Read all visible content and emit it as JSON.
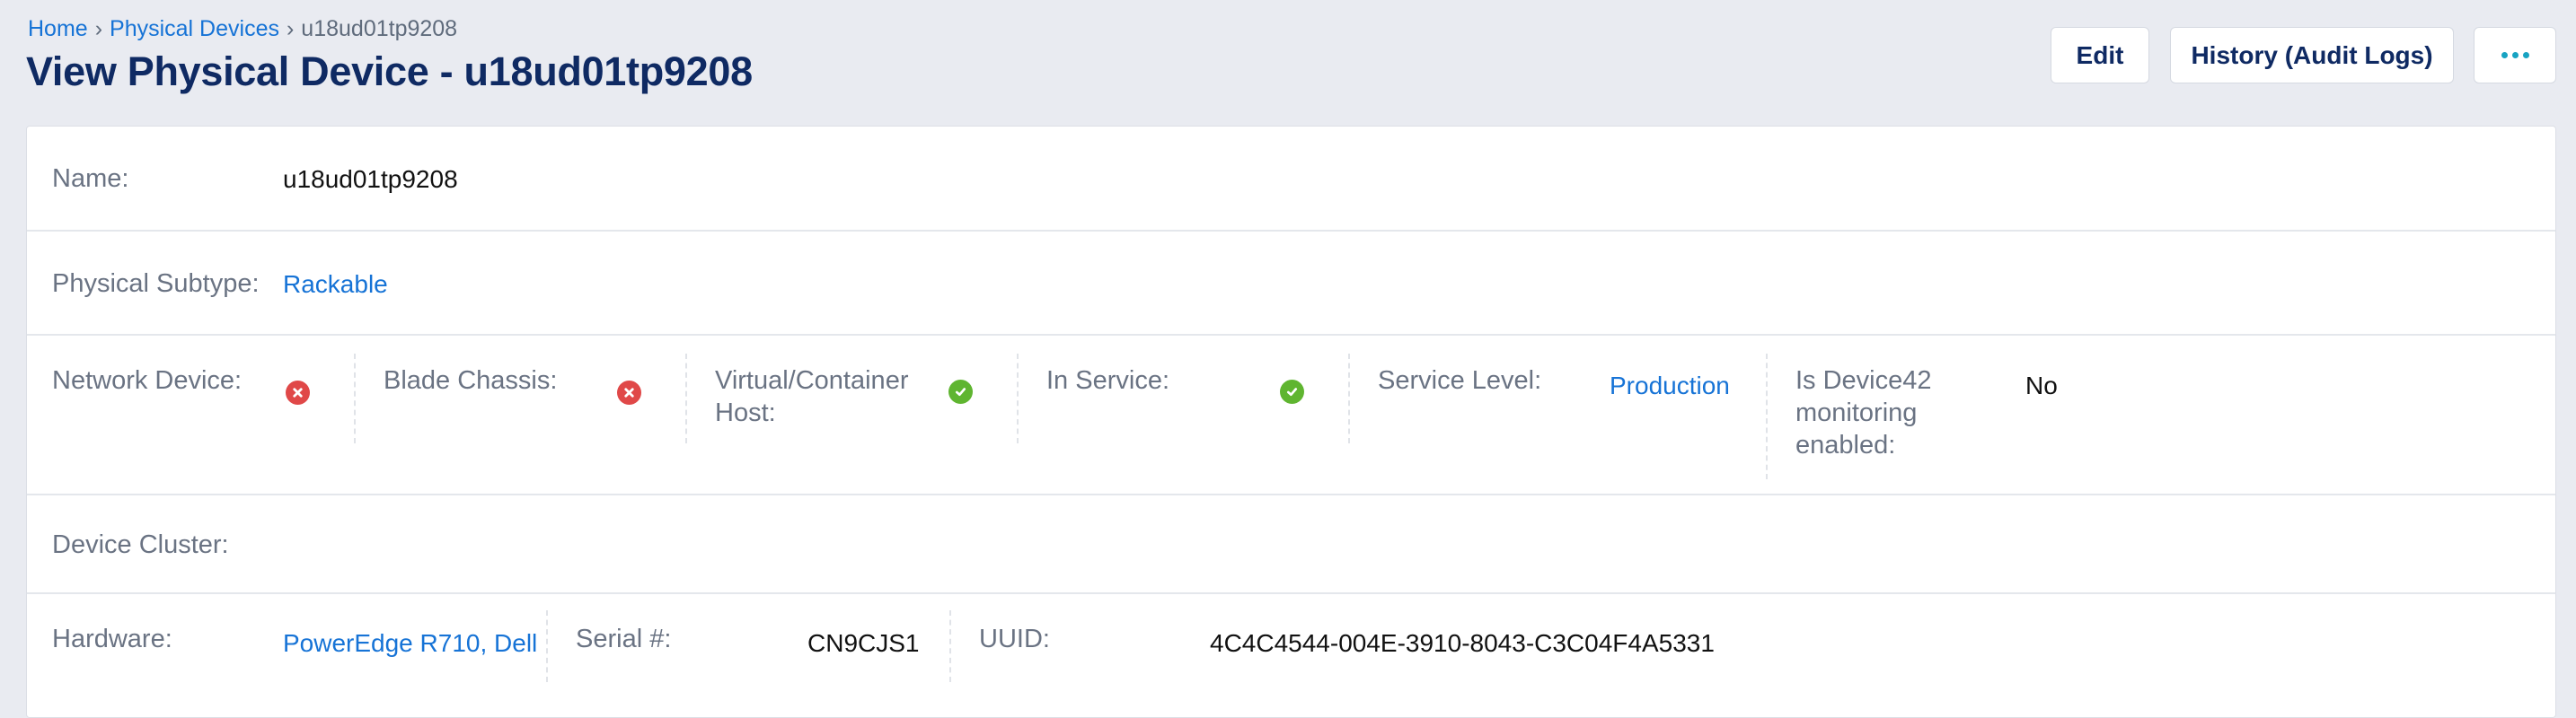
{
  "breadcrumb": {
    "home": "Home",
    "section": "Physical Devices",
    "current": "u18ud01tp9208"
  },
  "page": {
    "title": "View Physical Device - u18ud01tp9208"
  },
  "actions": {
    "edit": "Edit",
    "history": "History (Audit Logs)",
    "more_icon": "more-horizontal-icon"
  },
  "colors": {
    "accent_link": "#1673d6",
    "title": "#0f2a63",
    "status_no": "#e04848",
    "status_yes": "#5fb530",
    "more_dots": "#17a3c2"
  },
  "device": {
    "name": {
      "label": "Name:",
      "value": "u18ud01tp9208"
    },
    "physical_subtype": {
      "label": "Physical Subtype:",
      "value": "Rackable"
    },
    "network_device": {
      "label": "Network Device:",
      "value": false,
      "icon": "x-circle-icon"
    },
    "blade_chassis": {
      "label": "Blade Chassis:",
      "value": false,
      "icon": "x-circle-icon"
    },
    "virtual_host": {
      "label_line1": "Virtual/Container",
      "label_line2": "Host:",
      "value": true,
      "icon": "check-circle-icon"
    },
    "in_service": {
      "label": "In Service:",
      "value": true,
      "icon": "check-circle-icon"
    },
    "service_level": {
      "label": "Service Level:",
      "value": "Production"
    },
    "monitoring": {
      "label_line1": "Is Device42",
      "label_line2": "monitoring",
      "label_line3": "enabled:",
      "value": "No"
    },
    "device_cluster": {
      "label": "Device Cluster:",
      "value": ""
    },
    "hardware": {
      "label": "Hardware:",
      "value": "PowerEdge R710, Dell"
    },
    "serial": {
      "label": "Serial #:",
      "value": "CN9CJS1"
    },
    "uuid": {
      "label": "UUID:",
      "value": "4C4C4544-004E-3910-8043-C3C04F4A5331"
    }
  }
}
